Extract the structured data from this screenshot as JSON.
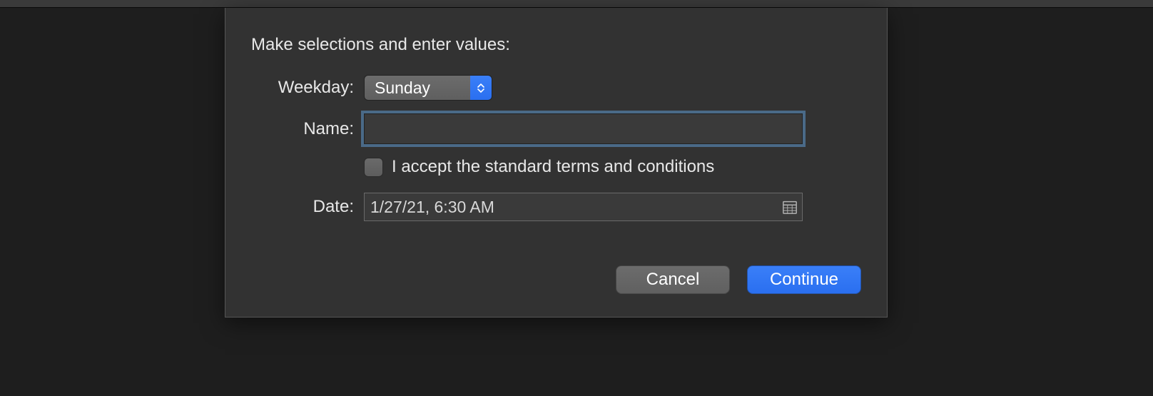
{
  "dialog": {
    "heading": "Make selections and enter values:",
    "weekday": {
      "label": "Weekday:",
      "value": "Sunday"
    },
    "name": {
      "label": "Name:",
      "value": ""
    },
    "terms": {
      "label": "I accept the standard terms and conditions",
      "checked": false
    },
    "date": {
      "label": "Date:",
      "value": "1/27/21, 6:30 AM"
    },
    "buttons": {
      "cancel": "Cancel",
      "continue": "Continue"
    }
  }
}
